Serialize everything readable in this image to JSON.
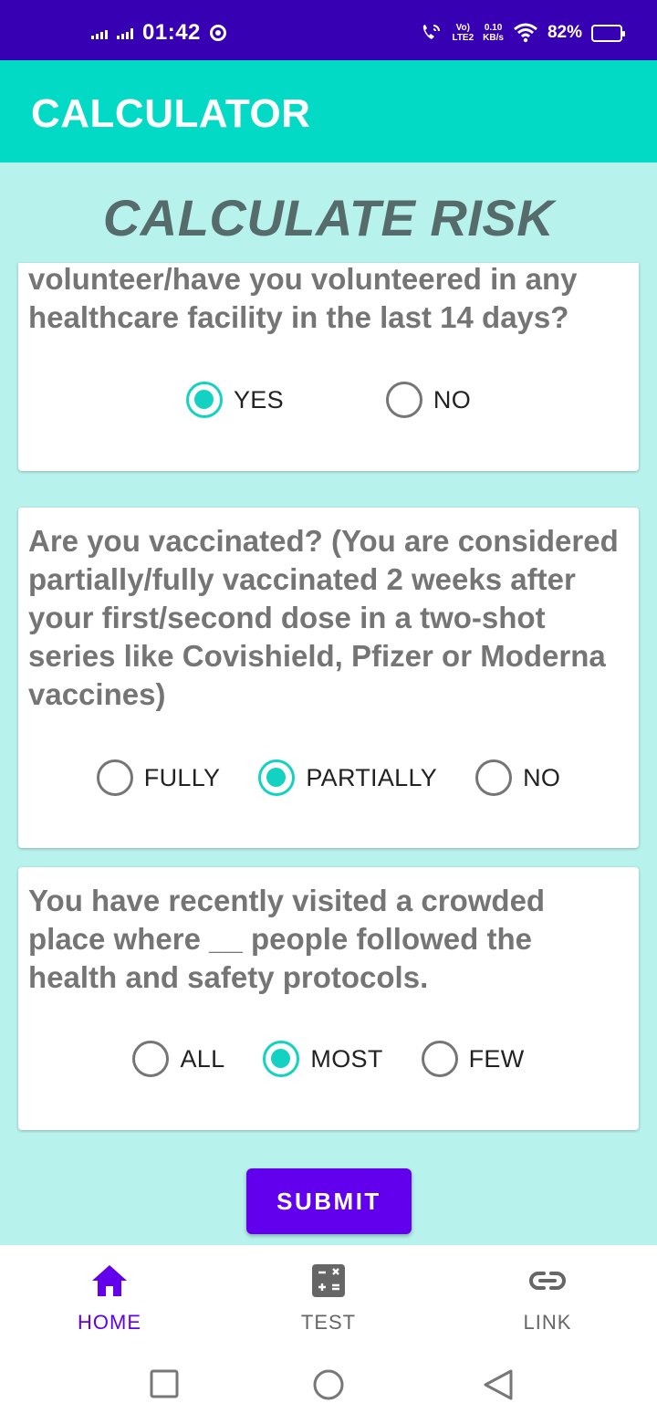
{
  "status_bar": {
    "time": "01:42",
    "volte_top": "Vo)",
    "volte_bottom": "LTE2",
    "speed_value": "0.10",
    "speed_unit": "KB/s",
    "battery": "82%"
  },
  "app_bar": {
    "title": "CALCULATOR"
  },
  "page": {
    "heading": "CALCULATE RISK"
  },
  "questions": [
    {
      "text": "volunteer/have you volunteered in any healthcare facility in the last 14 days?",
      "options": [
        "YES",
        "NO"
      ],
      "selected": "YES"
    },
    {
      "text": "Are you vaccinated? (You are considered partially/fully vaccinated 2 weeks after your first/second dose in a two-shot series like Covishield, Pfizer or Moderna vaccines)",
      "options": [
        "FULLY",
        "PARTIALLY",
        "NO"
      ],
      "selected": "PARTIALLY"
    },
    {
      "text": "You have recently visited a crowded place where __ people followed the health and safety protocols.",
      "options": [
        "ALL",
        "MOST",
        "FEW"
      ],
      "selected": "MOST"
    }
  ],
  "submit_label": "SUBMIT",
  "bottom_nav": {
    "items": [
      {
        "label": "HOME",
        "icon": "home-icon",
        "active": true
      },
      {
        "label": "TEST",
        "icon": "calculator-icon",
        "active": false
      },
      {
        "label": "LINK",
        "icon": "link-icon",
        "active": false
      }
    ]
  },
  "colors": {
    "status_bar": "#3700b3",
    "app_bar": "#03dac5",
    "background": "#b8f2ed",
    "accent": "#14d2c2",
    "primary": "#6200ee"
  }
}
